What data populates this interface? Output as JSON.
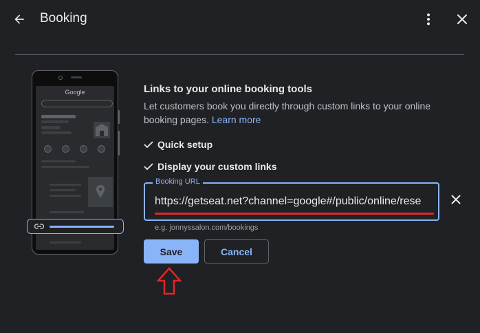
{
  "header": {
    "title": "Booking",
    "back_icon": "arrow-back-icon",
    "more_icon": "more-vert-icon",
    "close_icon": "close-icon"
  },
  "illustration": {
    "google_logo": "Google"
  },
  "content": {
    "heading": "Links to your online booking tools",
    "description": "Let customers book you directly through custom links to your online booking pages.",
    "learn_more": "Learn more",
    "checks": [
      {
        "label": "Quick setup",
        "icon": "checkmark-icon"
      },
      {
        "label": "Display your custom links",
        "icon": "checkmark-icon"
      }
    ]
  },
  "booking_url_field": {
    "label": "Booking URL",
    "value": "https://getseat.net?channel=google#/public/online/rese",
    "helper": "e.g. jonnyssalon.com/bookings",
    "clear_icon": "close-icon"
  },
  "buttons": {
    "save": "Save",
    "cancel": "Cancel"
  },
  "colors": {
    "background": "#202124",
    "accent": "#8ab4f8",
    "annotation_red": "#e3262b"
  }
}
